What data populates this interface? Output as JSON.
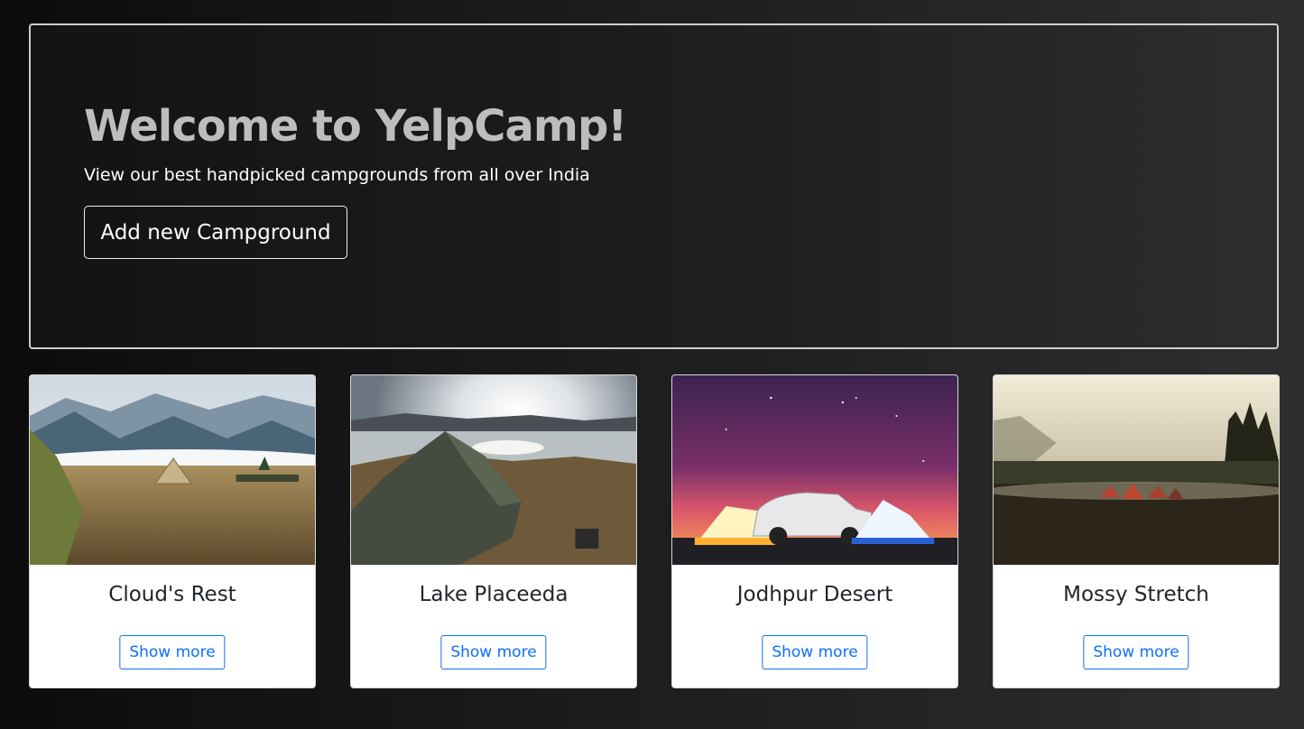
{
  "hero": {
    "title": "Welcome to YelpCamp!",
    "subtitle": "View our best handpicked campgrounds from all over India",
    "add_button_label": "Add new Campground"
  },
  "campgrounds": [
    {
      "name": "Cloud's Rest",
      "button_label": "Show more"
    },
    {
      "name": "Lake Placeeda",
      "button_label": "Show more"
    },
    {
      "name": "Jodhpur Desert",
      "button_label": "Show more"
    },
    {
      "name": "Mossy Stretch",
      "button_label": "Show more"
    }
  ],
  "colors": {
    "background": "#1c1c1c",
    "hero_title": "#bdbdbd",
    "card_background": "#ffffff",
    "button_accent": "#0d6efd"
  }
}
